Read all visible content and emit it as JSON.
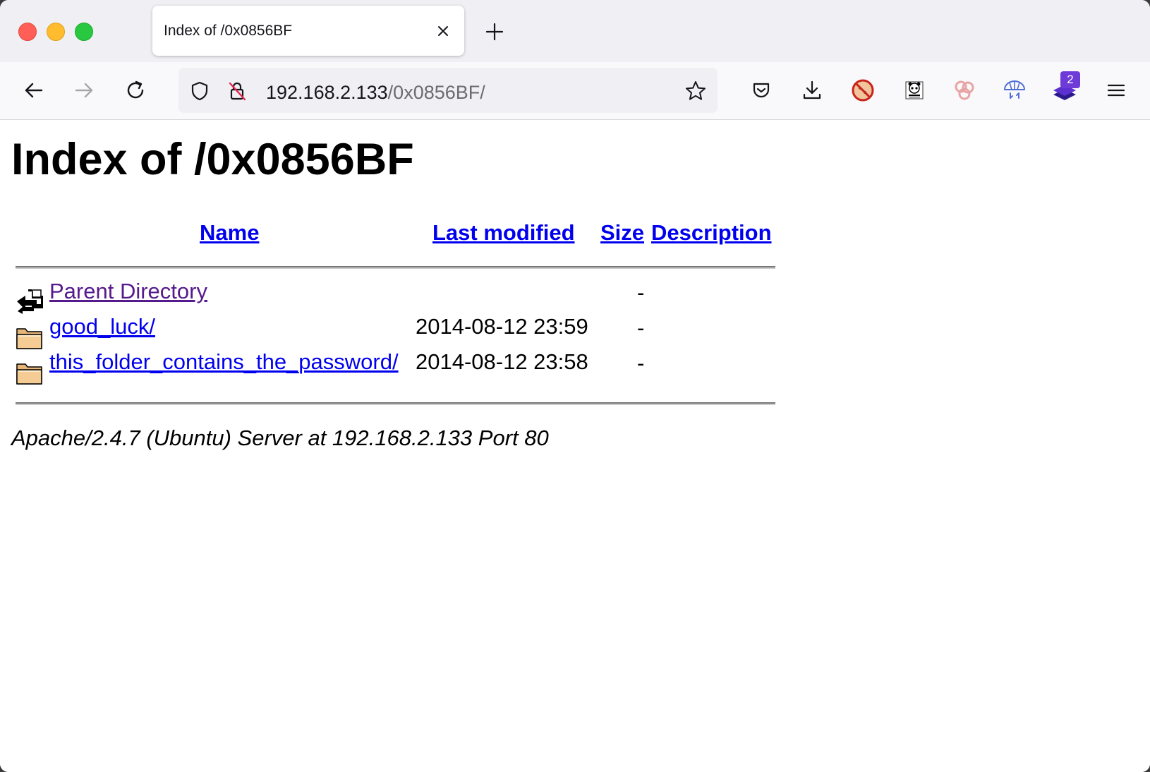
{
  "browser": {
    "tab": {
      "title": "Index of /0x0856BF"
    },
    "url": {
      "host": "192.168.2.133",
      "path": "/0x0856BF/"
    },
    "extension_badge": "2",
    "icons": {
      "back": "arrow-left-icon",
      "forward": "arrow-right-icon",
      "reload": "reload-icon",
      "tracking": "shield-icon",
      "insecure": "lock-slash-icon",
      "bookmark": "star-icon",
      "pocket": "pocket-icon",
      "downloads": "download-icon",
      "menu": "hamburger-menu-icon"
    }
  },
  "page": {
    "title": "Index of /0x0856BF",
    "columns": {
      "name": "Name",
      "last_modified": "Last modified",
      "size": "Size",
      "description": "Description"
    },
    "rows": [
      {
        "name": "Parent Directory",
        "date": "",
        "size": "-",
        "icon": "parent-directory-icon",
        "visited": true
      },
      {
        "name": "good_luck/",
        "date": "2014-08-12 23:59",
        "size": "-",
        "icon": "folder-icon",
        "visited": false
      },
      {
        "name": "this_folder_contains_the_password/",
        "date": "2014-08-12 23:58",
        "size": "-",
        "icon": "folder-icon",
        "visited": false
      }
    ],
    "footer": "Apache/2.4.7 (Ubuntu) Server at 192.168.2.133 Port 80"
  },
  "colors": {
    "link": "#0000ee",
    "visited_link": "#551a8b",
    "badge": "#6e3ad8"
  }
}
